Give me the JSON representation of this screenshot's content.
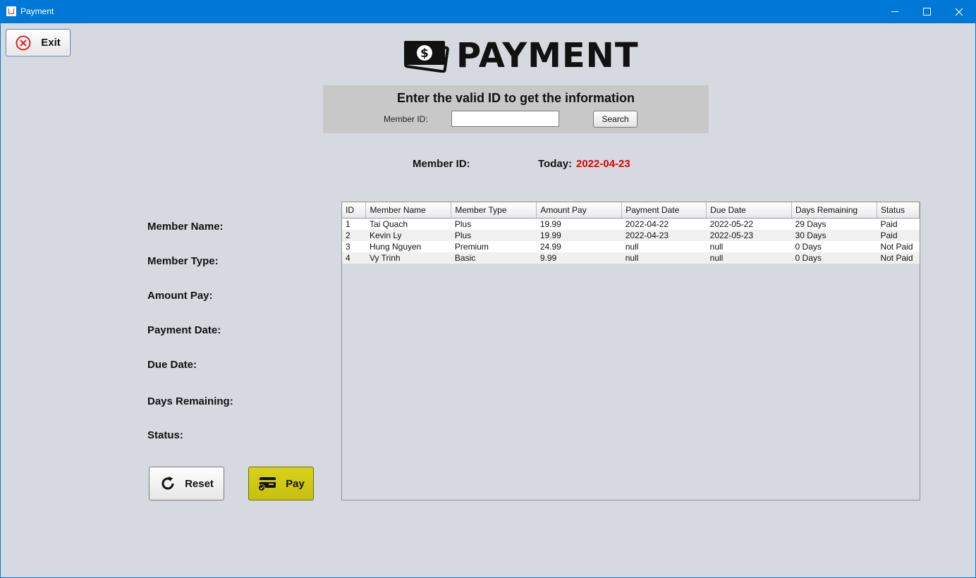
{
  "window": {
    "title": "Payment"
  },
  "exit_button": {
    "label": "Exit"
  },
  "header": {
    "title": "PAYMENT"
  },
  "search": {
    "prompt": "Enter the valid ID to get the information",
    "member_id_label": "Member ID:",
    "member_id_value": "",
    "button_label": "Search"
  },
  "info": {
    "member_id_label": "Member ID:",
    "member_id_value": "",
    "today_label": "Today:",
    "today_value": "2022-04-23",
    "today_color": "#e00000"
  },
  "details": {
    "member_name": "Member Name:",
    "member_type": "Member Type:",
    "amount_pay": "Amount Pay:",
    "payment_date": "Payment Date:",
    "due_date": "Due Date:",
    "days_remaining": "Days Remaining:",
    "status": "Status:"
  },
  "actions": {
    "reset_label": "Reset",
    "pay_label": "Pay",
    "pay_color": "#cfc914"
  },
  "table": {
    "columns": [
      "ID",
      "Member Name",
      "Member Type",
      "Amount Pay",
      "Payment Date",
      "Due Date",
      "Days Remaining",
      "Status"
    ],
    "rows": [
      [
        "1",
        "Tai  Quach",
        "Plus",
        "19.99",
        "2022-04-22",
        "2022-05-22",
        "29 Days",
        "Paid"
      ],
      [
        "2",
        "Kevin Ly",
        "Plus",
        "19.99",
        "2022-04-23",
        "2022-05-23",
        "30 Days",
        "Paid"
      ],
      [
        "3",
        "Hung Nguyen",
        "Premium",
        "24.99",
        "null",
        "null",
        "0 Days",
        "Not Paid"
      ],
      [
        "4",
        "Vy Trinh",
        "Basic",
        "9.99",
        "null",
        "null",
        "0 Days",
        "Not Paid"
      ]
    ]
  },
  "icons": {
    "app": "java-cup-icon",
    "exit": "close-circle-icon",
    "logo": "money-bill-icon",
    "reset": "refresh-icon",
    "pay": "credit-card-icon"
  }
}
